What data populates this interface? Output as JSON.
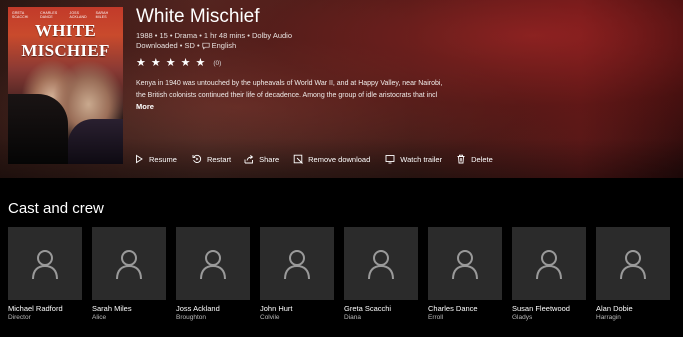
{
  "movie": {
    "title": "White Mischief",
    "meta_line": "1988 • 15 • Drama • 1 hr 48 mins • Dolby Audio",
    "availability": "Downloaded • SD •",
    "language": "English",
    "rating_count": "(0)",
    "stars": 5,
    "description_line1": "Kenya in 1940 was untouched by the upheavals of World War II, and at Happy Valley, near Nairobi,",
    "description_line2": "the British colonists continued their life of decadence. Among the group of idle aristocrats that incl",
    "more_label": "More"
  },
  "poster": {
    "title": "WHITE MISCHIEF",
    "credits": [
      "GRETA SCACCHI",
      "CHARLES DANCE",
      "JOSS ACKLAND",
      "SARAH MILES"
    ]
  },
  "actions": {
    "resume": "Resume",
    "restart": "Restart",
    "share": "Share",
    "remove_download": "Remove download",
    "watch_trailer": "Watch trailer",
    "delete": "Delete"
  },
  "cast_section": {
    "title": "Cast and crew",
    "members": [
      {
        "name": "Michael Radford",
        "role": "Director"
      },
      {
        "name": "Sarah Miles",
        "role": "Alice"
      },
      {
        "name": "Joss Ackland",
        "role": "Broughton"
      },
      {
        "name": "John Hurt",
        "role": "Colvile"
      },
      {
        "name": "Greta Scacchi",
        "role": "Diana"
      },
      {
        "name": "Charles Dance",
        "role": "Erroll"
      },
      {
        "name": "Susan Fleetwood",
        "role": "Gladys"
      },
      {
        "name": "Alan Dobie",
        "role": "Harragin"
      }
    ]
  }
}
